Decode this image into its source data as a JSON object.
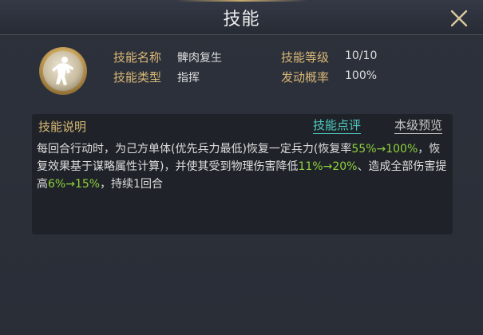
{
  "window": {
    "title": "技能",
    "close_icon": "close-x-icon"
  },
  "skill": {
    "icon": "soldier-silhouette-icon",
    "attrs": [
      {
        "label": "技能名称",
        "value": "髀肉复生"
      },
      {
        "label": "技能等级",
        "value": "10/10"
      },
      {
        "label": "技能类型",
        "value": "指挥"
      },
      {
        "label": "发动概率",
        "value": "100%"
      }
    ]
  },
  "description": {
    "title": "技能说明",
    "review_link": "技能点评",
    "preview_link": "本级预览",
    "segments": [
      {
        "text": "每回合行动时，为己方单体(优先兵力最低)恢复一定兵力(恢复率",
        "highlight": false
      },
      {
        "text": "55%→100%",
        "highlight": true
      },
      {
        "text": "，恢复效果基于谋略属性计算)，并使其受到物理伤害降低",
        "highlight": false
      },
      {
        "text": "11%→20%",
        "highlight": true
      },
      {
        "text": "、造成全部伤害提高",
        "highlight": false
      },
      {
        "text": "6%→15%",
        "highlight": true
      },
      {
        "text": "，持续1回合",
        "highlight": false
      }
    ]
  },
  "colors": {
    "label_gold": "#d9b875",
    "highlight_green": "#8fd23c",
    "link_teal": "#4fc9c0",
    "background": "#2a2e37"
  }
}
